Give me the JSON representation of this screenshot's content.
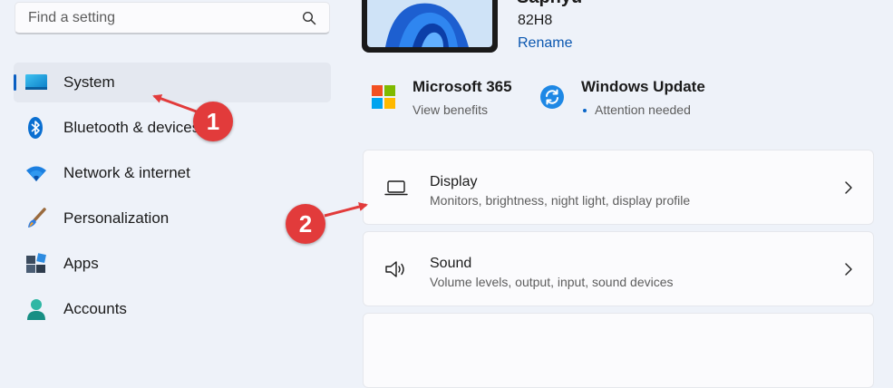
{
  "search": {
    "placeholder": "Find a setting",
    "icon": "search-icon"
  },
  "sidebar": {
    "items": [
      {
        "label": "System",
        "icon": "system-monitor-icon",
        "selected": true
      },
      {
        "label": "Bluetooth & devices",
        "icon": "bluetooth-icon"
      },
      {
        "label": "Network & internet",
        "icon": "wifi-icon"
      },
      {
        "label": "Personalization",
        "icon": "paintbrush-icon"
      },
      {
        "label": "Apps",
        "icon": "apps-icon"
      },
      {
        "label": "Accounts",
        "icon": "person-icon"
      }
    ]
  },
  "device": {
    "name": "Saphyu",
    "model": "82H8",
    "rename_label": "Rename"
  },
  "tiles": [
    {
      "title": "Microsoft 365",
      "subtitle": "View benefits",
      "icon": "microsoft-logo-icon"
    },
    {
      "title": "Windows Update",
      "subtitle": "Attention needed",
      "icon": "windows-update-icon"
    }
  ],
  "cards": [
    {
      "title": "Display",
      "subtitle": "Monitors, brightness, night light, display profile",
      "icon": "laptop-display-icon"
    },
    {
      "title": "Sound",
      "subtitle": "Volume levels, output, input, sound devices",
      "icon": "speaker-icon"
    }
  ],
  "annotations": {
    "badge1": "1",
    "badge2": "2"
  },
  "colors": {
    "accent": "#0a5fc2",
    "badge": "#e23b3b",
    "background": "#eef2f9"
  }
}
